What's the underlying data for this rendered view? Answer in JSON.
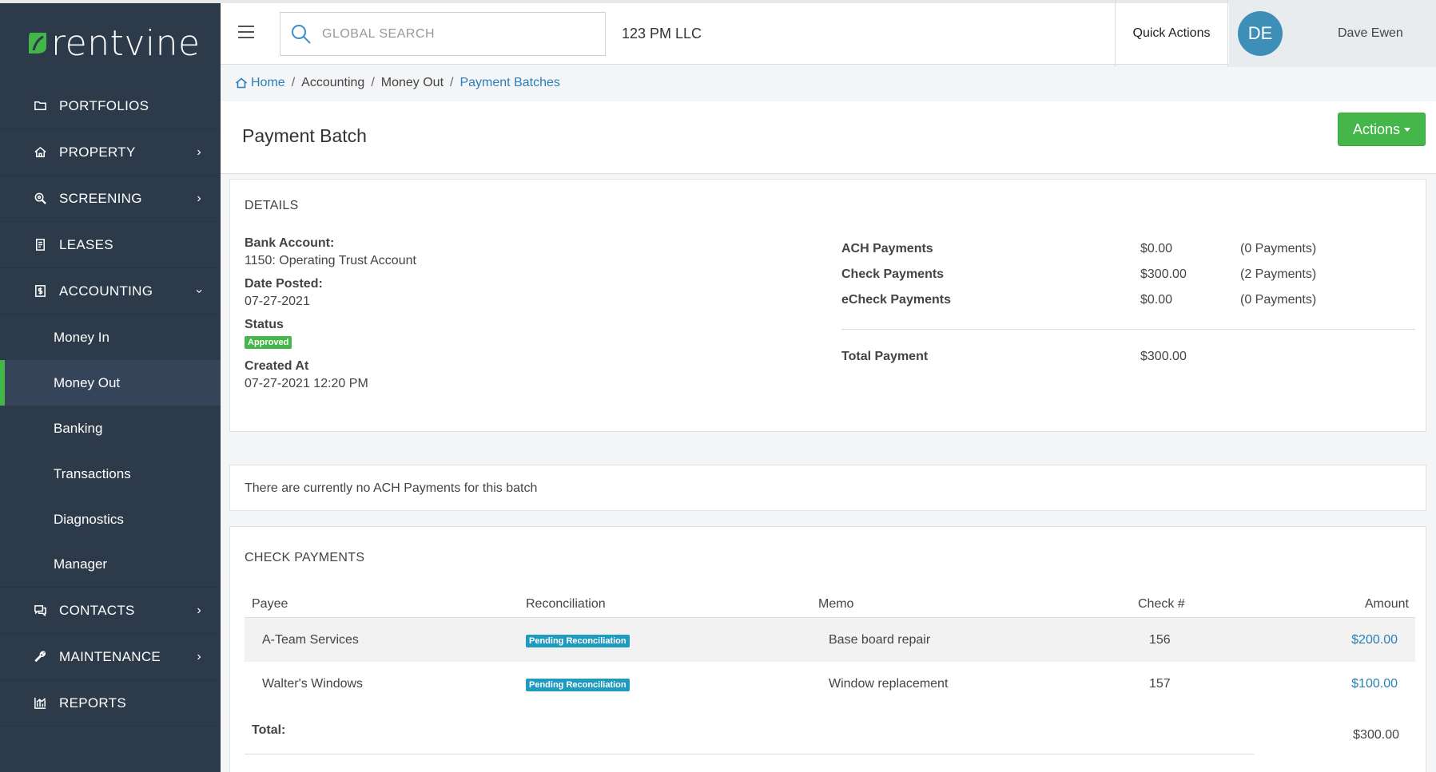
{
  "brand": {
    "name": "rentvine",
    "accent": "#44b649"
  },
  "sidebar": {
    "items": [
      {
        "label": "PORTFOLIOS",
        "icon": "folder-icon",
        "has_children": false
      },
      {
        "label": "PROPERTY",
        "icon": "home-icon",
        "has_children": true
      },
      {
        "label": "SCREENING",
        "icon": "search-zoom-icon",
        "has_children": true
      },
      {
        "label": "LEASES",
        "icon": "document-icon",
        "has_children": false
      },
      {
        "label": "ACCOUNTING",
        "icon": "dollar-box-icon",
        "has_children": true,
        "expanded": true
      }
    ],
    "accounting_sub": [
      "Money In",
      "Money Out",
      "Banking",
      "Transactions",
      "Diagnostics",
      "Manager"
    ],
    "active_sub": "Money Out",
    "items_after": [
      {
        "label": "CONTACTS",
        "icon": "chat-icon",
        "has_children": true
      },
      {
        "label": "MAINTENANCE",
        "icon": "wrench-icon",
        "has_children": true
      },
      {
        "label": "REPORTS",
        "icon": "chart-icon",
        "has_children": false
      }
    ]
  },
  "topbar": {
    "search_placeholder": "GLOBAL SEARCH",
    "company": "123 PM LLC",
    "quick_actions": "Quick Actions",
    "user_initials": "DE",
    "user_name": "Dave Ewen"
  },
  "breadcrumb": {
    "home": "Home",
    "b1": "Accounting",
    "b2": "Money Out",
    "current": "Payment Batches"
  },
  "page": {
    "title": "Payment Batch",
    "actions_label": "Actions"
  },
  "details": {
    "title": "DETAILS",
    "bank_account_label": "Bank Account:",
    "bank_account": "1150: Operating Trust Account",
    "date_posted_label": "Date Posted:",
    "date_posted": "07-27-2021",
    "status_label": "Status",
    "status": "Approved",
    "created_label": "Created At",
    "created": "07-27-2021 12:20 PM",
    "summary": [
      {
        "label": "ACH Payments",
        "amount": "$0.00",
        "count": "(0 Payments)"
      },
      {
        "label": "Check Payments",
        "amount": "$300.00",
        "count": "(2 Payments)"
      },
      {
        "label": "eCheck Payments",
        "amount": "$0.00",
        "count": "(0 Payments)"
      }
    ],
    "total_label": "Total Payment",
    "total_amount": "$300.00"
  },
  "no_ach": "There are currently no ACH Payments for this batch",
  "checks": {
    "title": "CHECK PAYMENTS",
    "headers": {
      "payee": "Payee",
      "reconciliation": "Reconciliation",
      "memo": "Memo",
      "check": "Check #",
      "amount": "Amount"
    },
    "rows": [
      {
        "payee": "A-Team Services",
        "reconciliation": "Pending Reconciliation",
        "memo": "Base board repair",
        "check": "156",
        "amount": "$200.00"
      },
      {
        "payee": "Walter's Windows",
        "reconciliation": "Pending Reconciliation",
        "memo": "Window replacement",
        "check": "157",
        "amount": "$100.00"
      }
    ],
    "total_label": "Total:",
    "total": "$300.00"
  }
}
